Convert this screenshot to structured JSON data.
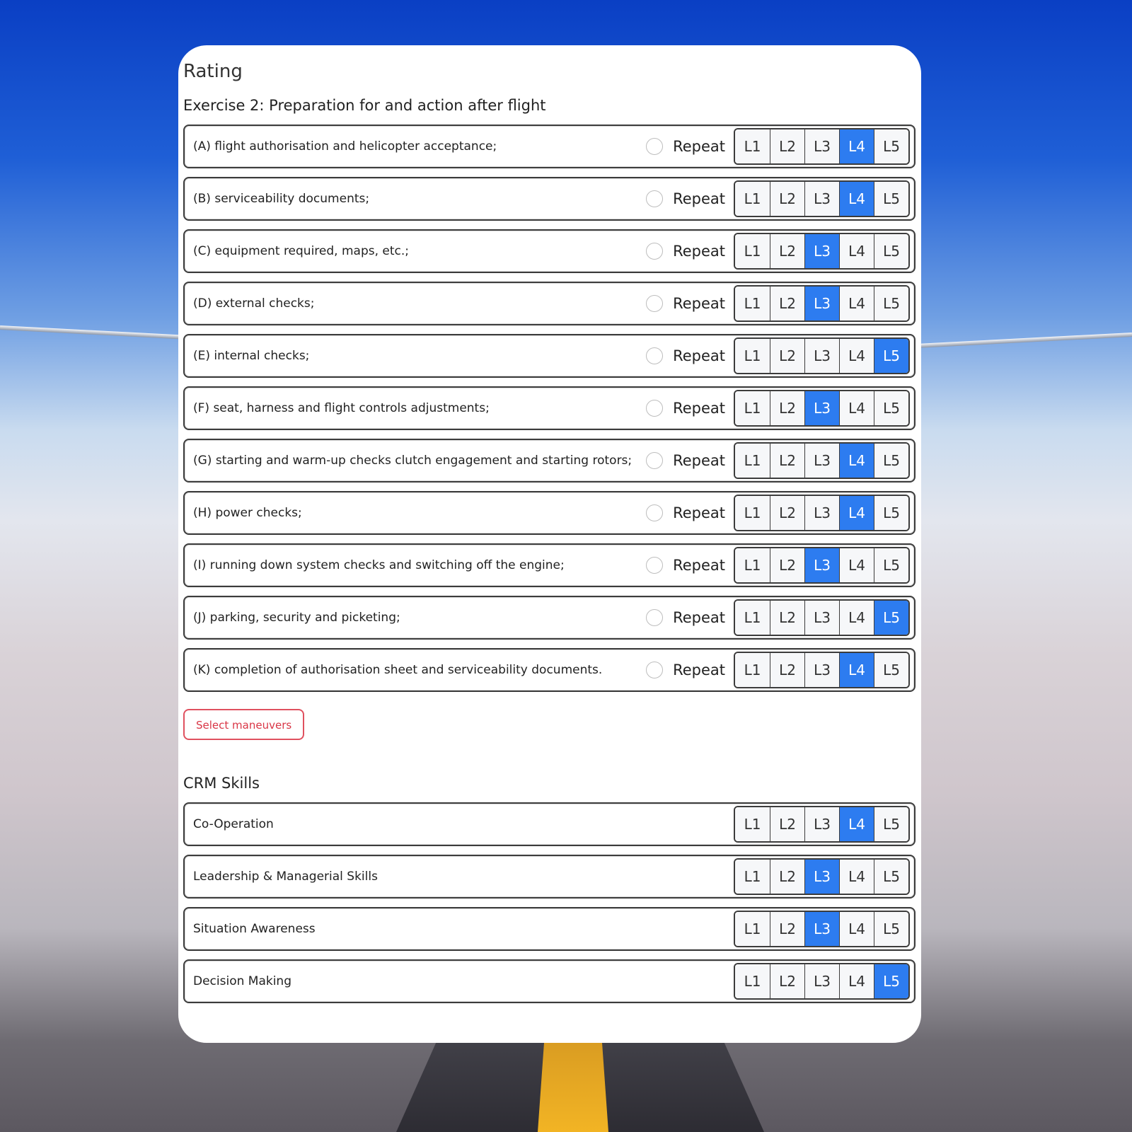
{
  "title": "Rating",
  "exercise": {
    "heading": "Exercise 2: Preparation for and action after flight",
    "repeat_label": "Repeat",
    "levels": [
      "L1",
      "L2",
      "L3",
      "L4",
      "L5"
    ],
    "items": [
      {
        "label": "(A) flight authorisation and helicopter acceptance;",
        "selected": "L4"
      },
      {
        "label": "(B) serviceability documents;",
        "selected": "L4"
      },
      {
        "label": "(C) equipment required, maps, etc.;",
        "selected": "L3"
      },
      {
        "label": "(D) external checks;",
        "selected": "L3"
      },
      {
        "label": "(E) internal checks;",
        "selected": "L5"
      },
      {
        "label": "(F) seat, harness and flight controls adjustments;",
        "selected": "L3"
      },
      {
        "label": "(G) starting and warm-up checks clutch engagement and starting rotors;",
        "selected": "L4"
      },
      {
        "label": "(H) power checks;",
        "selected": "L4"
      },
      {
        "label": "(I) running down system checks and switching off the engine;",
        "selected": "L3"
      },
      {
        "label": "(J) parking, security and picketing;",
        "selected": "L5"
      },
      {
        "label": "(K) completion of authorisation sheet and serviceability documents.",
        "selected": "L4"
      }
    ]
  },
  "select_maneuvers_label": "Select maneuvers",
  "crm": {
    "heading": "CRM Skills",
    "items": [
      {
        "label": "Co-Operation",
        "selected": "L4"
      },
      {
        "label": "Leadership & Managerial Skills",
        "selected": "L3"
      },
      {
        "label": "Situation Awareness",
        "selected": "L3"
      },
      {
        "label": "Decision Making",
        "selected": "L5"
      }
    ]
  },
  "colors": {
    "selected": "#2d7cf0",
    "danger": "#d93646"
  }
}
